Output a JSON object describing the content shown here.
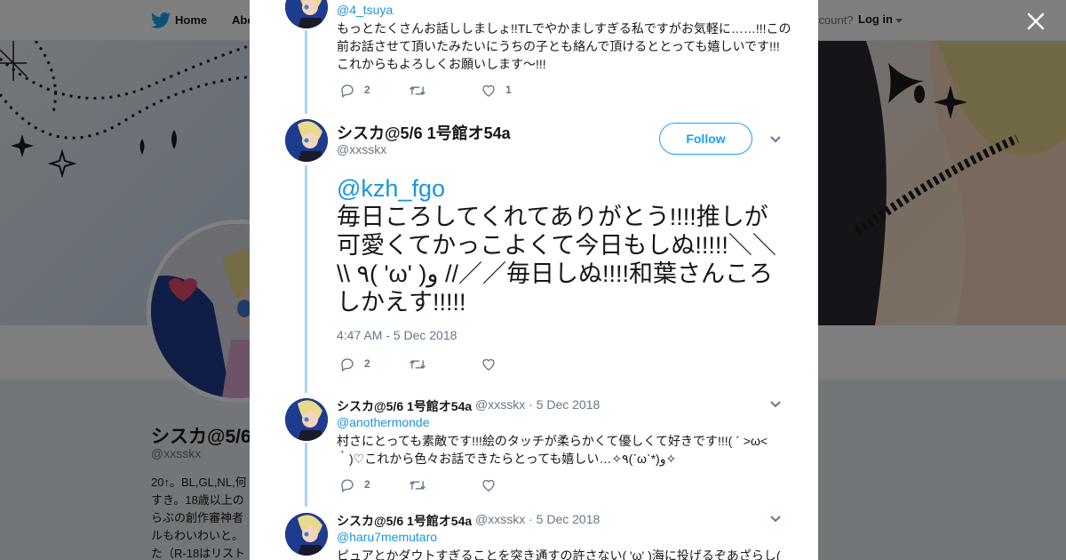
{
  "topnav": {
    "home_label": "Home",
    "about_label": "Abo",
    "account_label": "ccount?",
    "login_label": "Log in"
  },
  "background_profile": {
    "name": "シスカ@5/6",
    "handle": "@xxsskx",
    "bio_lines": [
      "20↑。BL,GL,NL,何",
      "すき。18歳以上の",
      "らぶの創作審神者",
      "ルもわいわいと。",
      "た（R-18はリスト"
    ]
  },
  "modal": {
    "close_label": "close",
    "parent_tweet": {
      "handle": "@4_tsuya",
      "text_lines": [
        "もっとたくさんお話ししましょ!!TLでやかましすぎる私ですがお気軽に……!!!この",
        "前お話させて頂いたみたいにうちの子とも絡んで頂けるととっても嬉しいです!!!",
        "これからもよろしくお願いします〜!!!"
      ],
      "reply_count": "2",
      "retweet_count": "",
      "like_count": "1"
    },
    "main_tweet": {
      "name": "シスカ@5/6 1号館オ54a",
      "handle": "@xxsskx",
      "follow_label": "Follow",
      "mention": "@kzh_fgo",
      "text": "毎日ころしてくれてありがとう!!!!推しが可愛くてかっこよくて今日もしぬ!!!!!＼＼\\\\ ٩( 'ω' )و //／／毎日しぬ!!!!和葉さんころしかえす!!!!!",
      "timestamp": "4:47 AM - 5 Dec 2018",
      "reply_count": "2",
      "retweet_count": "",
      "like_count": ""
    },
    "replies": [
      {
        "name": "シスカ@5/6 1号館オ54a",
        "meta": "@xxsskx · 5 Dec 2018",
        "mention": "@anothermonde",
        "text_lines": [
          "村さにとっても素敵です!!!絵のタッチが柔らかくて優しくて好きです!!!( ´ >ω<",
          "｀)♡これから色々お話できたらとっても嬉しい…✧٩(ˊωˋ*)و✧"
        ],
        "reply_count": "2",
        "retweet_count": "",
        "like_count": ""
      },
      {
        "name": "シスカ@5/6 1号館オ54a",
        "meta": "@xxsskx · 5 Dec 2018",
        "mention": "@haru7memutaro",
        "text_lines": [
          "ピュアとかダウトすぎることを突き通すの許さない( 'ω' )海に投げるぞあざらし("
        ]
      }
    ]
  },
  "colors": {
    "accent": "#1da1f2",
    "thread_line": "#a8d6f5",
    "text": "#14171a",
    "muted": "#657786"
  }
}
